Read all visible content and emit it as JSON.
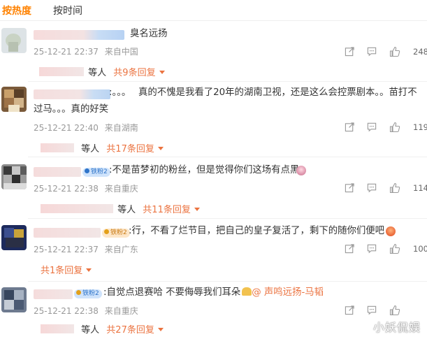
{
  "tabs": {
    "hot": "按热度",
    "time": "按时间"
  },
  "comments": [
    {
      "name_visible": "",
      "text_line1": "臭名远扬",
      "text_line2": "",
      "date": "25-12-21 22:37",
      "location": "来自中国",
      "likes": "248",
      "reply_etal": "等人",
      "reply_more": "共9条回复",
      "badge": "",
      "mention": ""
    },
    {
      "name_visible": ":。。。",
      "text_line1": "真的不愧是我看了20年的湖南卫视，还是这么会控票剧本。。苗打不",
      "text_line2": "过马。。。真的好笑",
      "date": "25-12-21 22:40",
      "location": "来自湖南",
      "likes": "119",
      "reply_etal": "等人",
      "reply_more": "共17条回复",
      "badge": "",
      "mention": ""
    },
    {
      "name_visible": "",
      "text_line1": ":不是苗梦初的粉丝，但是觉得你们这场有点黑",
      "text_line2": "",
      "date": "25-12-21 22:38",
      "location": "来自重庆",
      "likes": "114",
      "reply_etal": "等人",
      "reply_more": "共11条回复",
      "badge": "铁粉2",
      "mention": ""
    },
    {
      "name_visible": "",
      "text_line1": ":行，不看了烂节目，把自己的皇子复活了，剩下的随你们便吧",
      "text_line2": "",
      "date": "25-12-21 22:37",
      "location": "来自广东",
      "likes": "100",
      "reply_etal": "",
      "reply_more": "共1条回复",
      "badge": "铁粉2",
      "mention": ""
    },
    {
      "name_visible": "",
      "text_line1": ":自觉点退赛哈 不要侮辱我们耳朵",
      "text_line2": "",
      "date": "25-12-21 22:38",
      "location": "来自重庆",
      "likes": "",
      "reply_etal": "等人",
      "reply_more": "共27条回复",
      "badge": "铁粉2",
      "mention": "@ 声鸣远扬-马韬"
    }
  ],
  "watermark": "小妖侃娱",
  "colors": {
    "accent": "#ff8200",
    "reply_link": "#eb7340",
    "meta": "#999999"
  }
}
